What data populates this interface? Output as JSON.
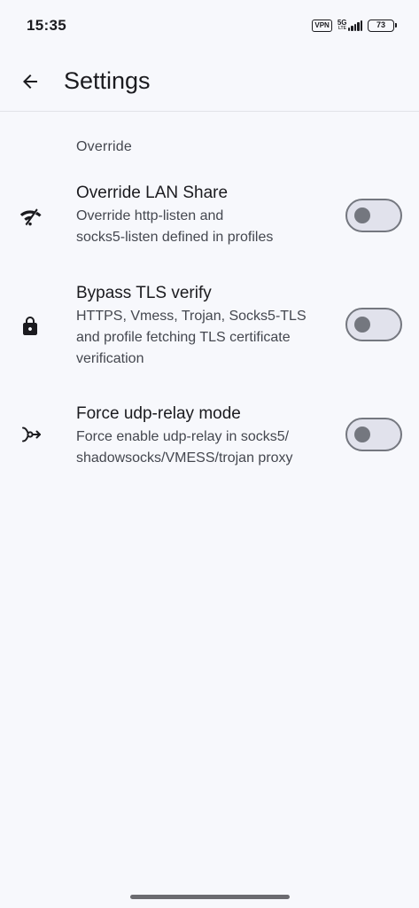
{
  "status_bar": {
    "time": "15:35",
    "vpn": "VPN",
    "network": "5G",
    "network_sub": "LTE",
    "battery": "73"
  },
  "app_bar": {
    "title": "Settings",
    "back_icon": "arrow-back-icon"
  },
  "section": {
    "title": "Override"
  },
  "settings": [
    {
      "icon": "wifi-off-icon",
      "title": "Override LAN Share",
      "desc_lines": [
        "Override http-listen and",
        "socks5-listen defined in profiles"
      ],
      "enabled": false
    },
    {
      "icon": "lock-icon",
      "title": "Bypass TLS verify",
      "desc_lines": [
        "HTTPS, Vmess, Trojan, Socks5-TLS",
        "and profile fetching TLS certificate",
        "verification"
      ],
      "enabled": false
    },
    {
      "icon": "call-merge-icon",
      "title": "Force udp-relay mode",
      "desc_lines": [
        "Force enable udp-relay in socks5/",
        "shadowsocks/VMESS/trojan proxy"
      ],
      "enabled": false
    }
  ],
  "colors": {
    "background": "#f7f8fc",
    "switch_track": "#e1e2ec",
    "switch_outline": "#74777f"
  }
}
